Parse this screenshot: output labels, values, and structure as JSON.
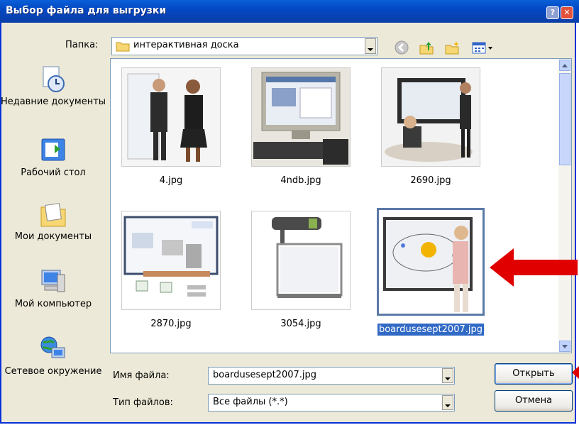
{
  "window": {
    "title": "Выбор файла для выгрузки",
    "help_glyph": "?",
    "close_glyph": "✕"
  },
  "lookin": {
    "label": "Папка:",
    "value": "интерактивная доска"
  },
  "places": [
    {
      "label": "Недавние документы",
      "icon": "recent-documents-icon"
    },
    {
      "label": "Рабочий стол",
      "icon": "desktop-icon"
    },
    {
      "label": "Мои документы",
      "icon": "my-documents-icon"
    },
    {
      "label": "Мой компьютер",
      "icon": "my-computer-icon"
    },
    {
      "label": "Сетевое окружение",
      "icon": "network-icon"
    }
  ],
  "files": [
    {
      "name": "4.jpg"
    },
    {
      "name": "4ndb.jpg"
    },
    {
      "name": "2690.jpg"
    },
    {
      "name": "2870.jpg"
    },
    {
      "name": "3054.jpg"
    },
    {
      "name": "boardusesept2007.jpg",
      "selected": true
    }
  ],
  "filename": {
    "label": "Имя файла:",
    "value": "boardusesept2007.jpg"
  },
  "filetype": {
    "label": "Тип файлов:",
    "value": "Все файлы (*.*)"
  },
  "buttons": {
    "open": "Открыть",
    "cancel": "Отмена"
  },
  "colors": {
    "title_bar": "#0a5fd8",
    "selection": "#316ac5",
    "annotation_arrow": "#e00000"
  }
}
